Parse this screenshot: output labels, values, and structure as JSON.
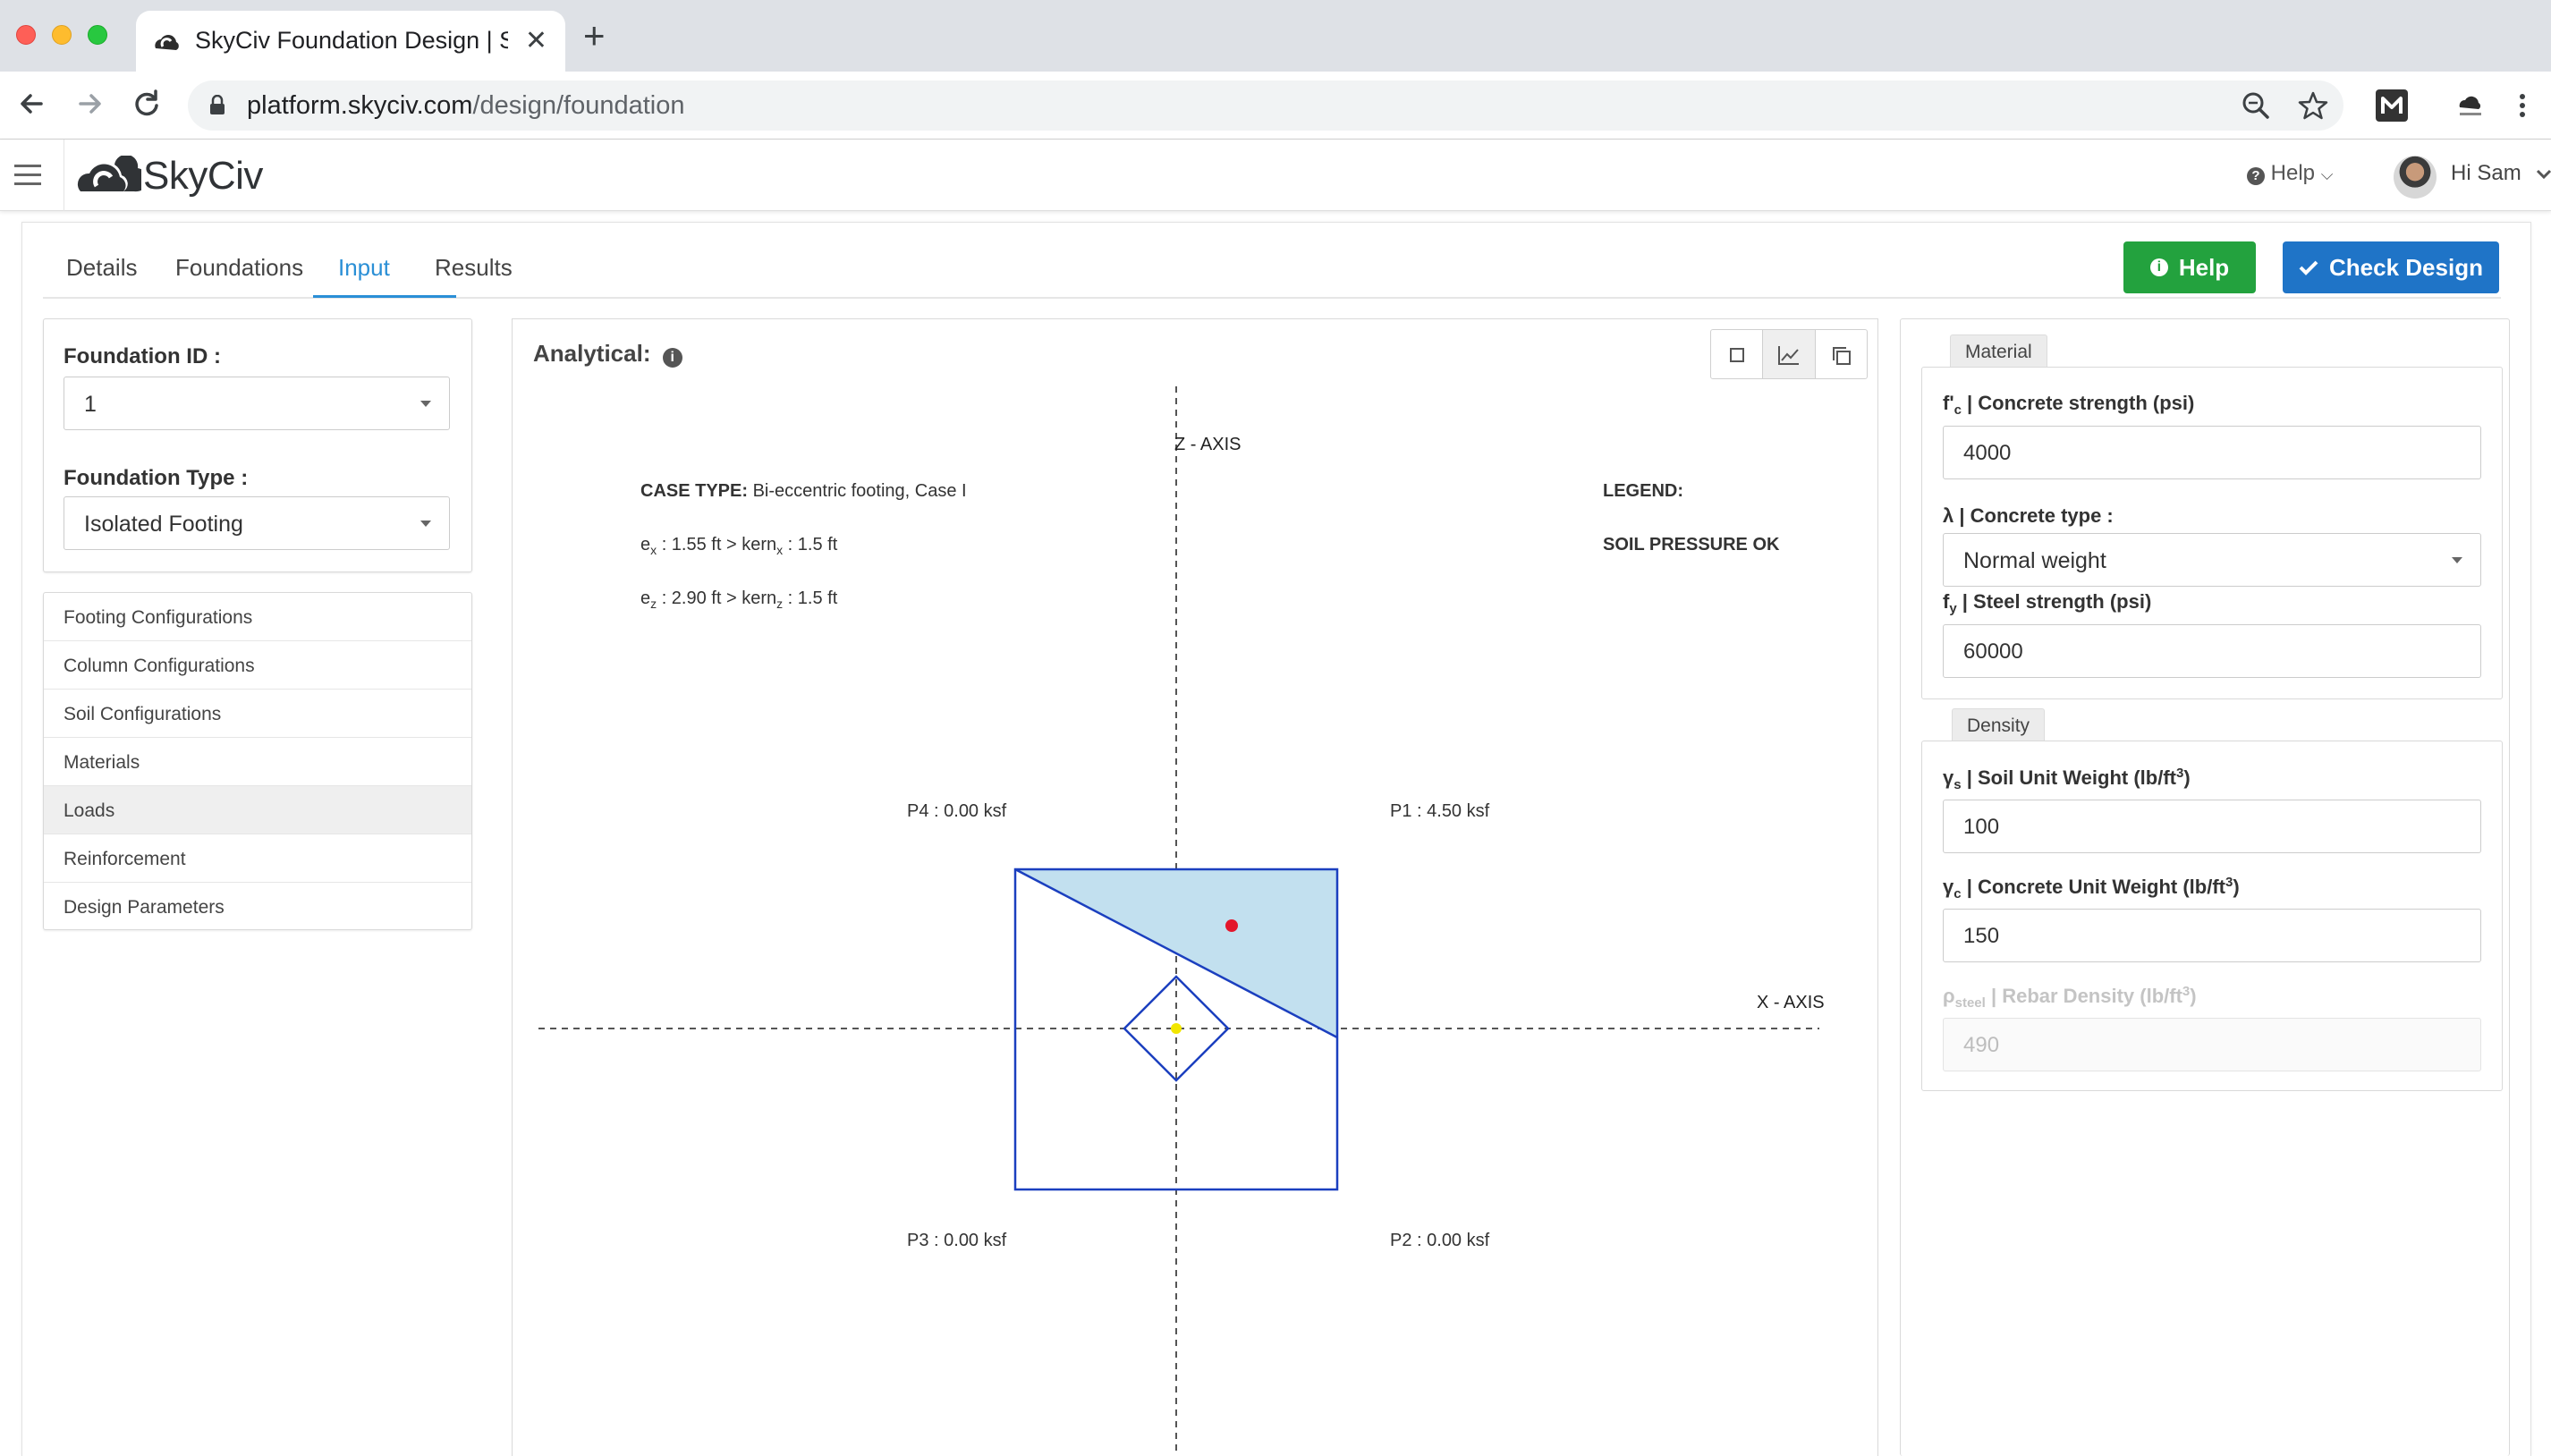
{
  "browser": {
    "tab_title": "SkyCiv Foundation Design | SkyCiv",
    "url_domain": "platform.skyciv.com",
    "url_path": "/design/foundation",
    "new_tab_label": "+",
    "close_tab_label": "✕"
  },
  "app": {
    "brand": "SkyCiv",
    "help_label": "Help",
    "user_label": "Hi Sam"
  },
  "tabs": [
    {
      "label": "Details",
      "active": false
    },
    {
      "label": "Foundations",
      "active": false
    },
    {
      "label": "Input",
      "active": true
    },
    {
      "label": "Results",
      "active": false
    }
  ],
  "actions": {
    "help": "Help",
    "check_design": "Check Design"
  },
  "foundation": {
    "id_label": "Foundation ID :",
    "id_value": "1",
    "type_label": "Foundation Type :",
    "type_value": "Isolated Footing"
  },
  "sidebar": {
    "items": [
      {
        "label": "Footing Configurations",
        "active": false
      },
      {
        "label": "Column Configurations",
        "active": false
      },
      {
        "label": "Soil Configurations",
        "active": false
      },
      {
        "label": "Materials",
        "active": false
      },
      {
        "label": "Loads",
        "active": true
      },
      {
        "label": "Reinforcement",
        "active": false
      },
      {
        "label": "Design Parameters",
        "active": false
      }
    ]
  },
  "analytical": {
    "title": "Analytical:",
    "z_axis": "Z - AXIS",
    "x_axis": "X - AXIS",
    "case_type_label": "CASE TYPE:",
    "case_type_value": "Bi-eccentric footing, Case I",
    "ex_label": "e",
    "ex_sub": "x",
    "ex_value": ": 1.55 ft > kern",
    "kern_x_sub": "x",
    "kern_x_value": ": 1.5 ft",
    "ez_label": "e",
    "ez_sub": "z",
    "ez_value": ": 2.90 ft > kern",
    "kern_z_sub": "z",
    "kern_z_value": ": 1.5 ft",
    "legend_label": "LEGEND:",
    "legend_status": "SOIL PRESSURE OK",
    "p1": "P1 : 4.50 ksf",
    "p2": "P2 : 0.00 ksf",
    "p3": "P3 : 0.00 ksf",
    "p4": "P4 : 0.00 ksf",
    "colors": {
      "footing_outline": "#1b3fbf",
      "pressure_fill": "#c2e0ef",
      "load_point": "#e3162b",
      "centroid": "#f2e600"
    }
  },
  "material": {
    "section": "Material",
    "fc_symbol": "f'",
    "fc_sub": "c",
    "fc_label": " | Concrete strength (psi)",
    "fc_value": "4000",
    "lambda_label": "λ | Concrete type :",
    "lambda_value": "Normal weight",
    "fy_symbol": "f",
    "fy_sub": "y",
    "fy_label": " | Steel strength (psi)",
    "fy_value": "60000"
  },
  "density": {
    "section": "Density",
    "soil_symbol": "γ",
    "soil_sub": "s",
    "soil_label": " | Soil Unit Weight (lb/ft",
    "soil_sup": "3",
    "soil_close": ")",
    "soil_value": "100",
    "conc_symbol": "γ",
    "conc_sub": "c",
    "conc_label": " | Concrete Unit Weight (lb/ft",
    "conc_sup": "3",
    "conc_close": ")",
    "conc_value": "150",
    "rebar_symbol": "ρ",
    "rebar_sub": "steel",
    "rebar_label": " | Rebar Density (lb/ft",
    "rebar_sup": "3",
    "rebar_close": ")",
    "rebar_value": "490"
  }
}
